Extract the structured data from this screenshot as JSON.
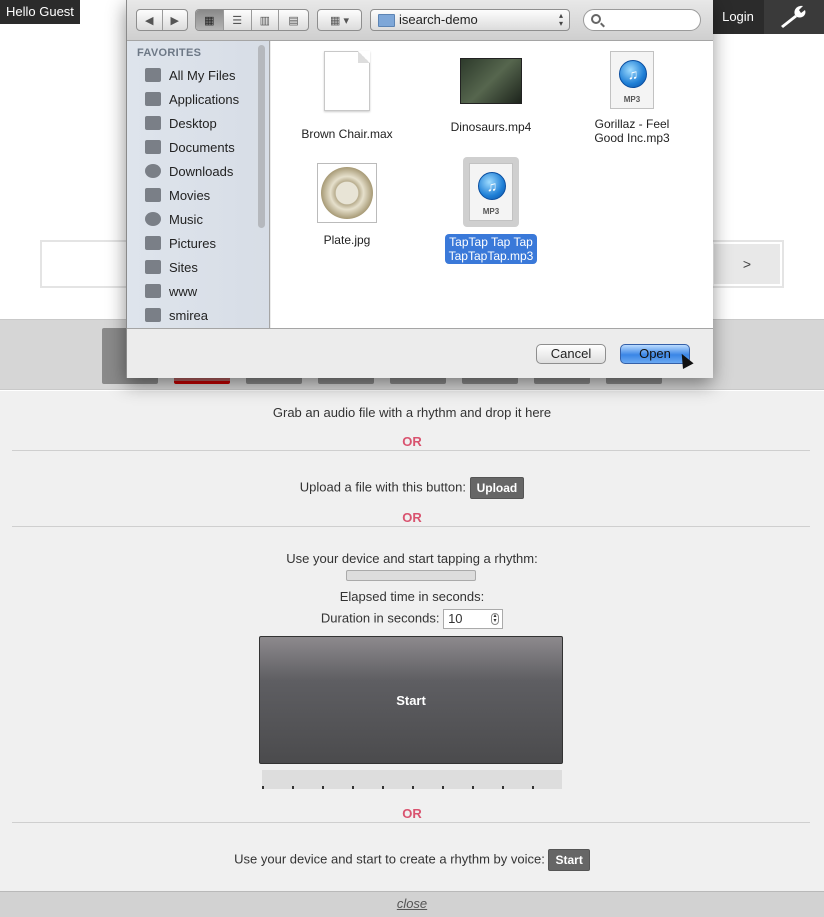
{
  "topbar": {
    "greeting": "Hello Guest",
    "login_label": "Login",
    "settings_icon": "wrench-icon"
  },
  "search": {
    "go_label": ">"
  },
  "panel": {
    "drop_text": "Grab an audio file with a rhythm and drop it here",
    "or_label": "OR",
    "upload_text": "Upload a file with this button:",
    "upload_label": "Upload",
    "tap_text": "Use your device and start tapping a rhythm:",
    "elapsed_text": "Elapsed time in seconds:",
    "duration_text": "Duration in seconds:",
    "duration_value": "10",
    "start_label": "Start",
    "voice_text": "Use your device and start to create a rhythm by voice:",
    "voice_start_label": "Start",
    "close_label": "close"
  },
  "dialog": {
    "location": "isearch-demo",
    "search_placeholder": "",
    "sidebar_heading": "FAVORITES",
    "sidebar_items": [
      {
        "label": "All My Files",
        "icon": "all-files-icon"
      },
      {
        "label": "Applications",
        "icon": "applications-icon"
      },
      {
        "label": "Desktop",
        "icon": "desktop-icon"
      },
      {
        "label": "Documents",
        "icon": "documents-icon"
      },
      {
        "label": "Downloads",
        "icon": "downloads-icon"
      },
      {
        "label": "Movies",
        "icon": "movies-icon"
      },
      {
        "label": "Music",
        "icon": "music-icon"
      },
      {
        "label": "Pictures",
        "icon": "pictures-icon"
      },
      {
        "label": "Sites",
        "icon": "folder-icon"
      },
      {
        "label": "www",
        "icon": "folder-icon"
      },
      {
        "label": "smirea",
        "icon": "home-icon"
      }
    ],
    "files": [
      {
        "name": "Brown Chair.max",
        "type": "document"
      },
      {
        "name": "Dinosaurs.mp4",
        "type": "video"
      },
      {
        "name_line1": "Gorillaz - Feel",
        "name_line2": "Good Inc.mp3",
        "type": "mp3",
        "badge": "MP3"
      },
      {
        "name": "Plate.jpg",
        "type": "image"
      },
      {
        "name_line1": "TapTap Tap Tap",
        "name_line2": "TapTapTap.mp3",
        "type": "mp3",
        "badge": "MP3",
        "selected": true
      }
    ],
    "cancel_label": "Cancel",
    "open_label": "Open"
  }
}
